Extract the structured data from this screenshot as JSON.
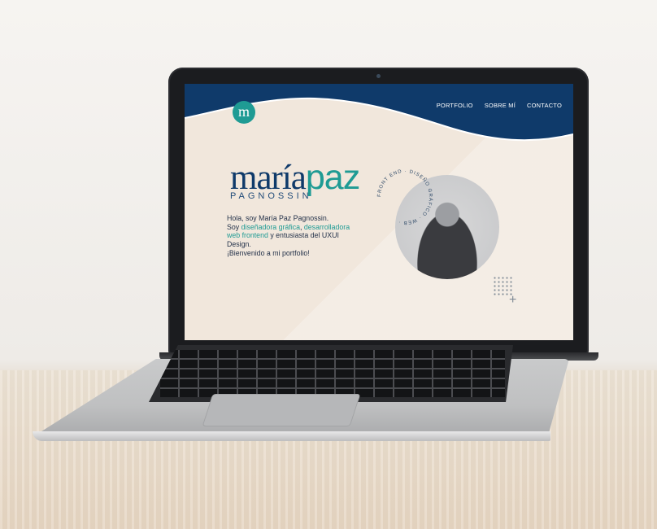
{
  "site": {
    "logo": "m",
    "nav": [
      "PORTFOLIO",
      "SOBRE MÍ",
      "CONTACTO"
    ],
    "name_first": "maría",
    "name_second": "paz",
    "surname": "PAGNOSSIN",
    "intro_line1": "Hola, soy María Paz Pagnossin.",
    "intro_soy": "Soy ",
    "intro_hl1": "diseñadora gráfica",
    "intro_comma": ", ",
    "intro_hl2": "desarrolladora web frontend",
    "intro_rest": " y entusiasta del UXUI Design.",
    "intro_welcome": "¡Bienvenido a mi portfolio!",
    "badge_text": "FRONT END · DISEÑO GRÁFICO · WEB ·"
  },
  "colors": {
    "navy": "#0f3a6a",
    "teal": "#1f9b94",
    "cream": "#f1e7dc"
  }
}
